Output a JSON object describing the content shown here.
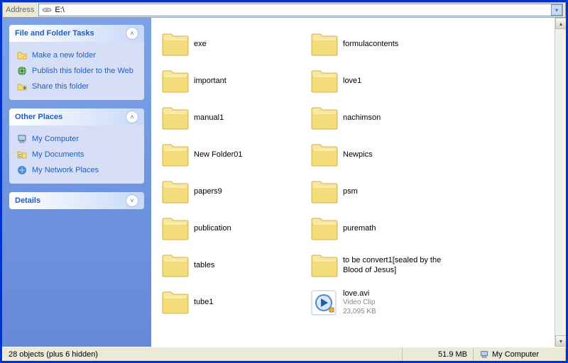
{
  "address": {
    "label": "Address",
    "value": "E:\\"
  },
  "sidebar": {
    "panels": [
      {
        "title": "File and Folder Tasks",
        "chev": "˄",
        "links": [
          {
            "label": "Make a new folder",
            "icon": "folder-new"
          },
          {
            "label": "Publish this folder to the Web",
            "icon": "globe"
          },
          {
            "label": "Share this folder",
            "icon": "share"
          }
        ]
      },
      {
        "title": "Other Places",
        "chev": "˄",
        "links": [
          {
            "label": "My Computer",
            "icon": "computer"
          },
          {
            "label": "My Documents",
            "icon": "docs"
          },
          {
            "label": "My Network Places",
            "icon": "network"
          }
        ]
      },
      {
        "title": "Details",
        "chev": "˅",
        "links": []
      }
    ]
  },
  "items": [
    {
      "name": "exe",
      "type": "folder"
    },
    {
      "name": "formulacontents",
      "type": "folder"
    },
    {
      "name": "important",
      "type": "folder"
    },
    {
      "name": "love1",
      "type": "folder"
    },
    {
      "name": "manual1",
      "type": "folder"
    },
    {
      "name": "nachimson",
      "type": "folder"
    },
    {
      "name": "New Folder01",
      "type": "folder"
    },
    {
      "name": "Newpics",
      "type": "folder"
    },
    {
      "name": "papers9",
      "type": "folder"
    },
    {
      "name": "psm",
      "type": "folder"
    },
    {
      "name": "publication",
      "type": "folder"
    },
    {
      "name": "puremath",
      "type": "folder"
    },
    {
      "name": "tables",
      "type": "folder"
    },
    {
      "name": "to be convert1[sealed by the Blood of Jesus]",
      "type": "folder"
    },
    {
      "name": "tube1",
      "type": "folder"
    },
    {
      "name": "love.avi",
      "type": "video",
      "sub1": "Video Clip",
      "sub2": "23,095 KB"
    }
  ],
  "status": {
    "objects": "28 objects (plus 6 hidden)",
    "size": "51.9 MB",
    "location": "My Computer"
  }
}
